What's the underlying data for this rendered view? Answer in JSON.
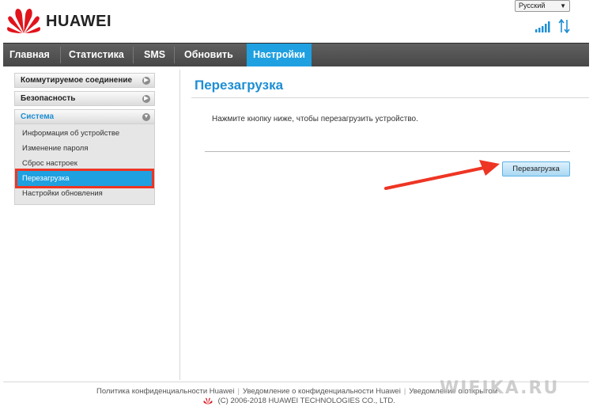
{
  "header": {
    "brand": "HUAWEI",
    "language": "Русский",
    "logo_icon": "huawei-logo-icon",
    "signal_icon": "signal-bars-icon",
    "transfer_icon": "up-down-arrows-icon"
  },
  "nav": {
    "items": [
      {
        "label": "Главная"
      },
      {
        "label": "Статистика"
      },
      {
        "label": "SMS"
      },
      {
        "label": "Обновить"
      },
      {
        "label": "Настройки"
      }
    ],
    "active": "Настройки"
  },
  "sidebar": {
    "groups": [
      {
        "label": "Коммутируемое соединение",
        "expanded": false
      },
      {
        "label": "Безопасность",
        "expanded": false
      },
      {
        "label": "Система",
        "expanded": true
      }
    ],
    "system_items": [
      {
        "label": "Информация об устройстве"
      },
      {
        "label": "Изменение пароля"
      },
      {
        "label": "Сброс настроек"
      },
      {
        "label": "Перезагрузка"
      },
      {
        "label": "Настройки обновления"
      }
    ],
    "active_item": "Перезагрузка"
  },
  "content": {
    "title": "Перезагрузка",
    "description": "Нажмите кнопку ниже, чтобы перезагрузить устройство.",
    "reboot_button": "Перезагрузка"
  },
  "footer": {
    "links": [
      "Политика конфиденциальности Huawei",
      "Уведомление о конфиденциальности Huawei",
      "Уведомление о открытом"
    ],
    "copyright": "(C) 2006-2018 HUAWEI TECHNOLOGIES CO., LTD.",
    "watermark": "WIFIKA.RU"
  },
  "colors": {
    "accent": "#1fa0e0",
    "highlight": "#ee3524",
    "nav_bg": "#505050"
  }
}
